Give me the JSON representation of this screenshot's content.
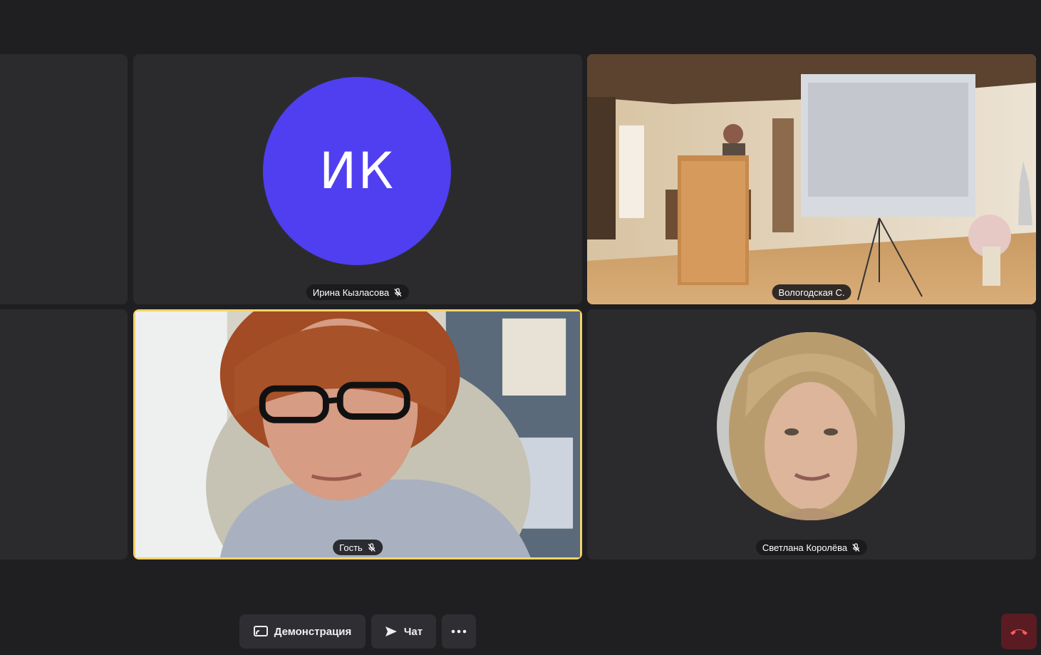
{
  "participants": [
    {
      "name": "Ирина Кызласова",
      "initials": "ИК",
      "muted": true,
      "avatar_color": "#4f3ff0"
    },
    {
      "name": "Вологодская С.",
      "muted": false,
      "video": true
    },
    {
      "name": "Гость",
      "muted": true,
      "video": true,
      "speaking": true
    },
    {
      "name": "Светлана Королёва",
      "muted": true,
      "avatar": "photo"
    }
  ],
  "toolbar": {
    "screen_share_label": "Демонстрация",
    "chat_label": "Чат",
    "more_icon": "more-horizontal-icon",
    "hangup_icon": "phone-hangup-icon"
  },
  "colors": {
    "background": "#1f1f21",
    "tile": "#2b2b2e",
    "active_border": "#f2d36b",
    "hangup": "#5a1c22"
  }
}
